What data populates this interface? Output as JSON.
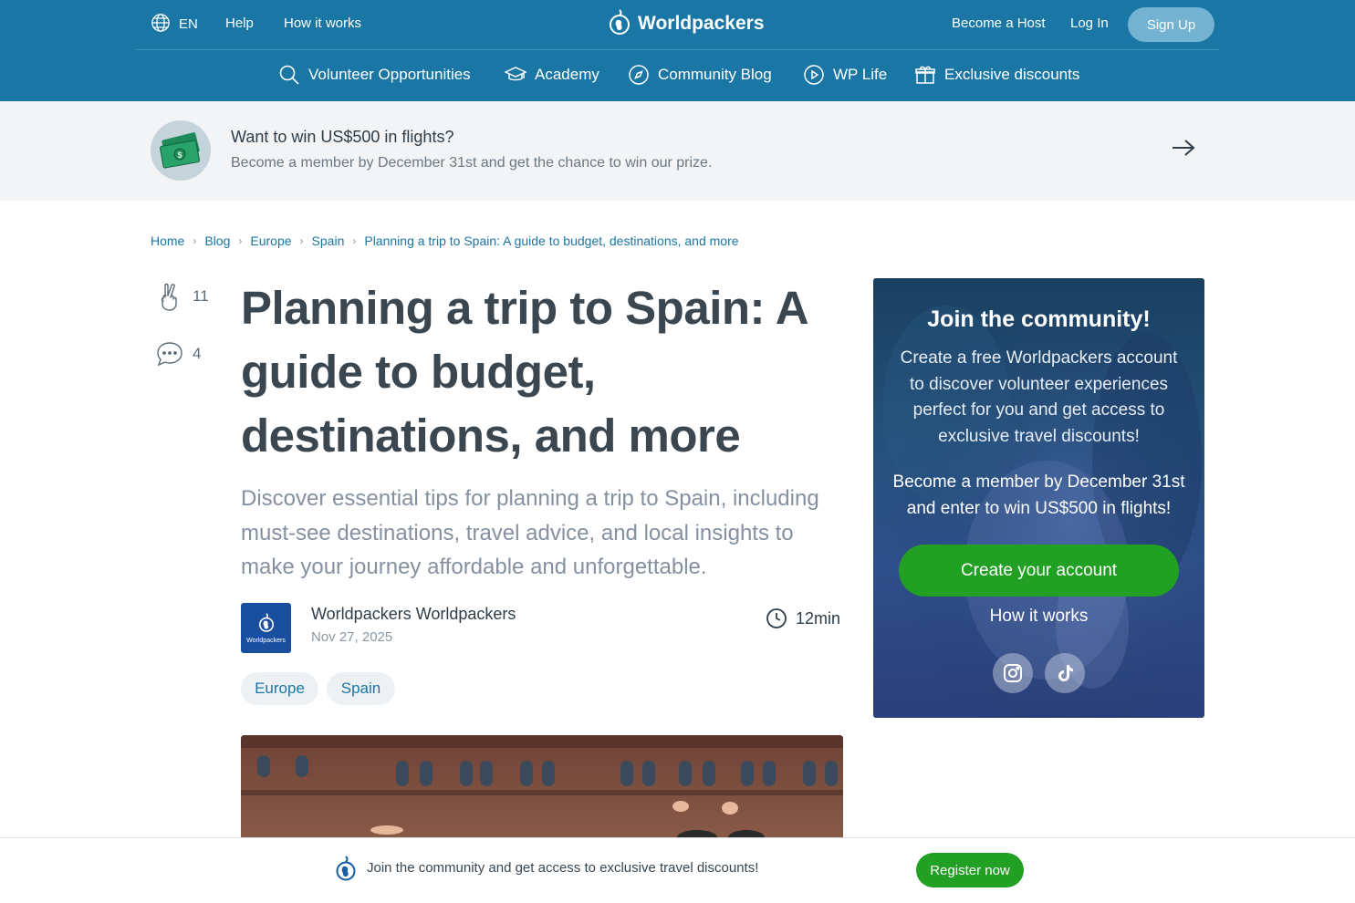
{
  "header": {
    "language": "EN",
    "help": "Help",
    "how_it_works": "How it works",
    "brand": "Worldpackers",
    "become_host": "Become a Host",
    "login": "Log In",
    "signup": "Sign Up"
  },
  "nav": {
    "items": [
      {
        "label": "Volunteer Opportunities",
        "icon": "search-icon"
      },
      {
        "label": "Academy",
        "icon": "graduation-cap-icon"
      },
      {
        "label": "Community Blog",
        "icon": "compass-icon"
      },
      {
        "label": "WP Life",
        "icon": "play-circle-icon"
      },
      {
        "label": "Exclusive discounts",
        "icon": "gift-icon"
      }
    ]
  },
  "promo": {
    "title": "Want to win US$500 in flights?",
    "subtitle": "Become a member by December 31st and get the chance to win our prize.",
    "icon": "money-icon"
  },
  "breadcrumb": [
    "Home",
    "Blog",
    "Europe",
    "Spain",
    "Planning a trip to Spain: A guide to budget, destinations, and more"
  ],
  "reactions": {
    "likes": "11",
    "comments": "4"
  },
  "article": {
    "title": "Planning a trip to Spain: A guide to budget, destinations, and more",
    "lead": "Discover essential tips for planning a trip to Spain, including must-see destinations, travel advice, and local insights to make your journey affordable and unforgettable.",
    "author": "Worldpackers Worldpackers",
    "author_logo_text": "Worldpackers",
    "date": "Nov 27, 2025",
    "read_time": "12min",
    "tags": [
      "Europe",
      "Spain"
    ]
  },
  "card": {
    "title": "Join the community!",
    "text": "Create a free Worldpackers account to discover volunteer experiences perfect for you and get access to exclusive travel discounts!",
    "promo": "Become a member by December 31st and enter to win US$500 in flights!",
    "cta": "Create your account",
    "how": "How it works",
    "social": [
      "instagram-icon",
      "tiktok-icon"
    ]
  },
  "sticky": {
    "text": "Join the community and get access to exclusive travel discounts!",
    "button": "Register now"
  },
  "colors": {
    "header": "#1976a5",
    "accent_green": "#21a023",
    "link": "#1976a5",
    "promo_bg": "#f2f4f6"
  }
}
